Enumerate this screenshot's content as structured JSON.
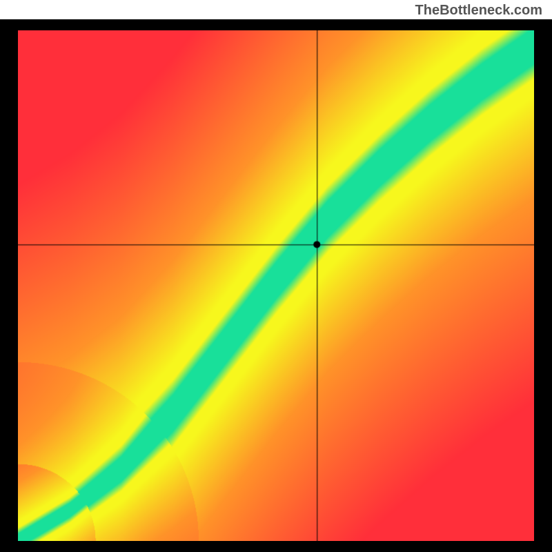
{
  "watermark": "TheBottleneck.com",
  "chart_data": {
    "type": "heatmap",
    "title": "",
    "xlabel": "",
    "ylabel": "",
    "xlim": [
      0,
      100
    ],
    "ylim": [
      0,
      100
    ],
    "crosshair": {
      "x": 58,
      "y": 58
    },
    "marker": {
      "x": 58,
      "y": 58
    },
    "description": "Bottleneck heatmap with diagonal green optimal band curving from bottom-left to top-right, yellow transition, red/orange corners",
    "optimal_curve_points": [
      {
        "x": 0,
        "y": 0
      },
      {
        "x": 10,
        "y": 6
      },
      {
        "x": 20,
        "y": 14
      },
      {
        "x": 30,
        "y": 25
      },
      {
        "x": 40,
        "y": 38
      },
      {
        "x": 50,
        "y": 51
      },
      {
        "x": 60,
        "y": 63
      },
      {
        "x": 70,
        "y": 73
      },
      {
        "x": 80,
        "y": 82
      },
      {
        "x": 90,
        "y": 90
      },
      {
        "x": 100,
        "y": 97
      }
    ],
    "band_width_normalized": 0.08,
    "color_stops": {
      "optimal": "#18e09a",
      "good": "#f7f71d",
      "warning": "#ff9329",
      "bad": "#ff2f3a"
    }
  }
}
